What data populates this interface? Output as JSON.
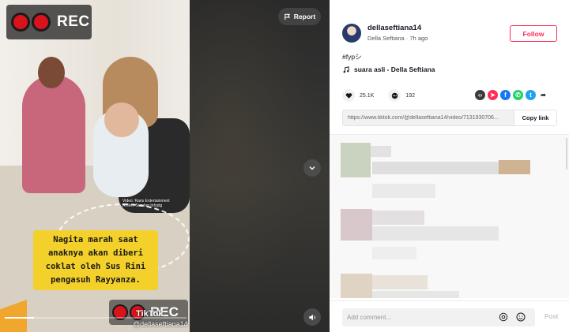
{
  "video": {
    "rec_label": "REC",
    "credit_line1": "Video: Rans Entertainment",
    "credit_line2": "Artikel: Sumber.Infojdg",
    "caption_lines": [
      "Nagita marah saat",
      "anaknya akan diberi",
      "coklat oleh Sus Rini",
      "pengasuh Rayyanza."
    ],
    "watermark": "TikTok",
    "watermark_handle": "@dellaseftiana14",
    "progress_fraction": 0.16,
    "report_label": "Report"
  },
  "post": {
    "username": "dellaseftiana14",
    "display_name": "Della Seftiana",
    "time_ago": "7h ago",
    "separator": "·",
    "follow_label": "Follow",
    "caption": "#fypシ",
    "sound": "suara asli - Della Seftiana",
    "likes": "25.1K",
    "comments_count": "192",
    "link": "https://www.tiktok.com/@dellaseftiana14/video/7131930706...",
    "copy_label": "Copy link"
  },
  "share_icons": [
    {
      "name": "embed-icon",
      "color": "#3b3b3b",
      "glyph": "‹›"
    },
    {
      "name": "send-icon",
      "color": "#fe2c55",
      "glyph": "➤"
    },
    {
      "name": "facebook-icon",
      "color": "#1877f2",
      "glyph": "f"
    },
    {
      "name": "whatsapp-icon",
      "color": "#25d366",
      "glyph": "✆"
    },
    {
      "name": "twitter-icon",
      "color": "#1da1f2",
      "glyph": "t"
    },
    {
      "name": "forward-icon",
      "color": "#ffffff",
      "glyph": "➦"
    }
  ],
  "comment_box": {
    "placeholder": "Add comment...",
    "post_label": "Post"
  },
  "colors": {
    "accent": "#fe2c55",
    "caption_bg": "#f4d02a",
    "rec_red": "#d9121b"
  }
}
